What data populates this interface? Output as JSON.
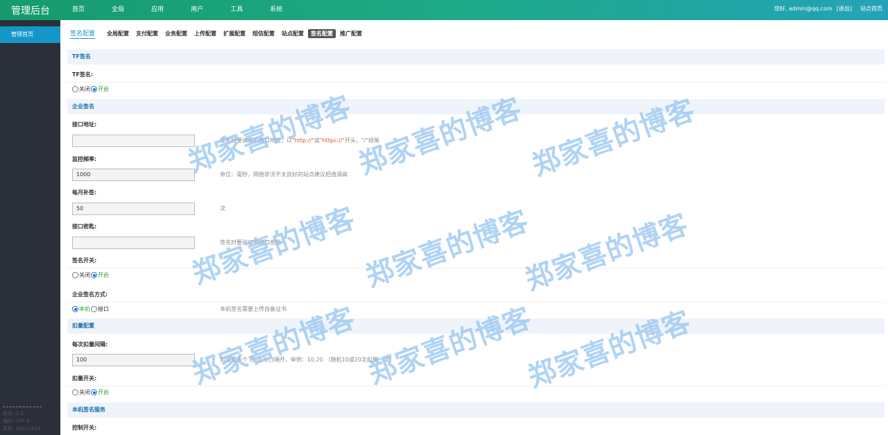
{
  "app": {
    "title": "管理后台"
  },
  "nav": [
    "首页",
    "全局",
    "应用",
    "用户",
    "工具",
    "系统"
  ],
  "user": {
    "greeting": "您好, admin@qq.com",
    "logout": "[退出]",
    "site_home": "站点首页"
  },
  "sidebar": {
    "active_item": "管理首页",
    "info": [
      "版本: 2.3",
      "编码: UTF-8",
      "更新: 20210523"
    ]
  },
  "tabs": {
    "title": "签名配置",
    "items": [
      "全局配置",
      "支付配置",
      "业务配置",
      "上传配置",
      "扩展配置",
      "短信配置",
      "站点配置",
      "签名配置",
      "推广配置"
    ],
    "active": "签名配置"
  },
  "sections": {
    "tf": "TF签名",
    "enterprise": "企业签名",
    "deduct": "扣量配置",
    "local": "本机签名服务"
  },
  "fields": {
    "tf_sign": {
      "label": "TF签名:",
      "off": "关闭",
      "on": "开启",
      "value": "on"
    },
    "api_url": {
      "label": "接口地址:",
      "value": "",
      "hint_pre": "签名时要请求的接口地址，以",
      "hint_http": "\"http://\"",
      "hint_mid": "或",
      "hint_https": "\"https://\"",
      "hint_post": "开头，\"/\"结尾"
    },
    "monitor_freq": {
      "label": "监控频率:",
      "value": "1000",
      "hint": "单位：毫秒，网络状况不太良好的站点建议把值调高"
    },
    "monthly_resign": {
      "label": "每月补签:",
      "value": "50",
      "hint": "次"
    },
    "api_key": {
      "label": "接口密匙:",
      "value": "",
      "hint": "签名时要验证的接口密匙"
    },
    "sign_switch": {
      "label": "签名开关:",
      "off": "关闭",
      "on": "开启",
      "value": "on"
    },
    "ent_mode": {
      "label": "企业签名方式:",
      "local": "本机",
      "api": "接口",
      "value": "local",
      "hint": "本机签名需要上传自备证书"
    },
    "deduct_interval": {
      "label": "每次扣量间隔:",
      "value": "100",
      "hint": "若设置多个 用 逗号(,)隔开，举例：10,20 （随机10或20次扣量一次）"
    },
    "deduct_switch": {
      "label": "扣量开关:",
      "off": "关闭",
      "on": "开启",
      "value": "on"
    },
    "control_switch": {
      "label": "控制开关:"
    }
  },
  "watermark": "郑家喜的博客",
  "colors": {
    "accent": "#1497c8",
    "on_text": "#2aa52a",
    "hint_red": "#e0522e"
  }
}
